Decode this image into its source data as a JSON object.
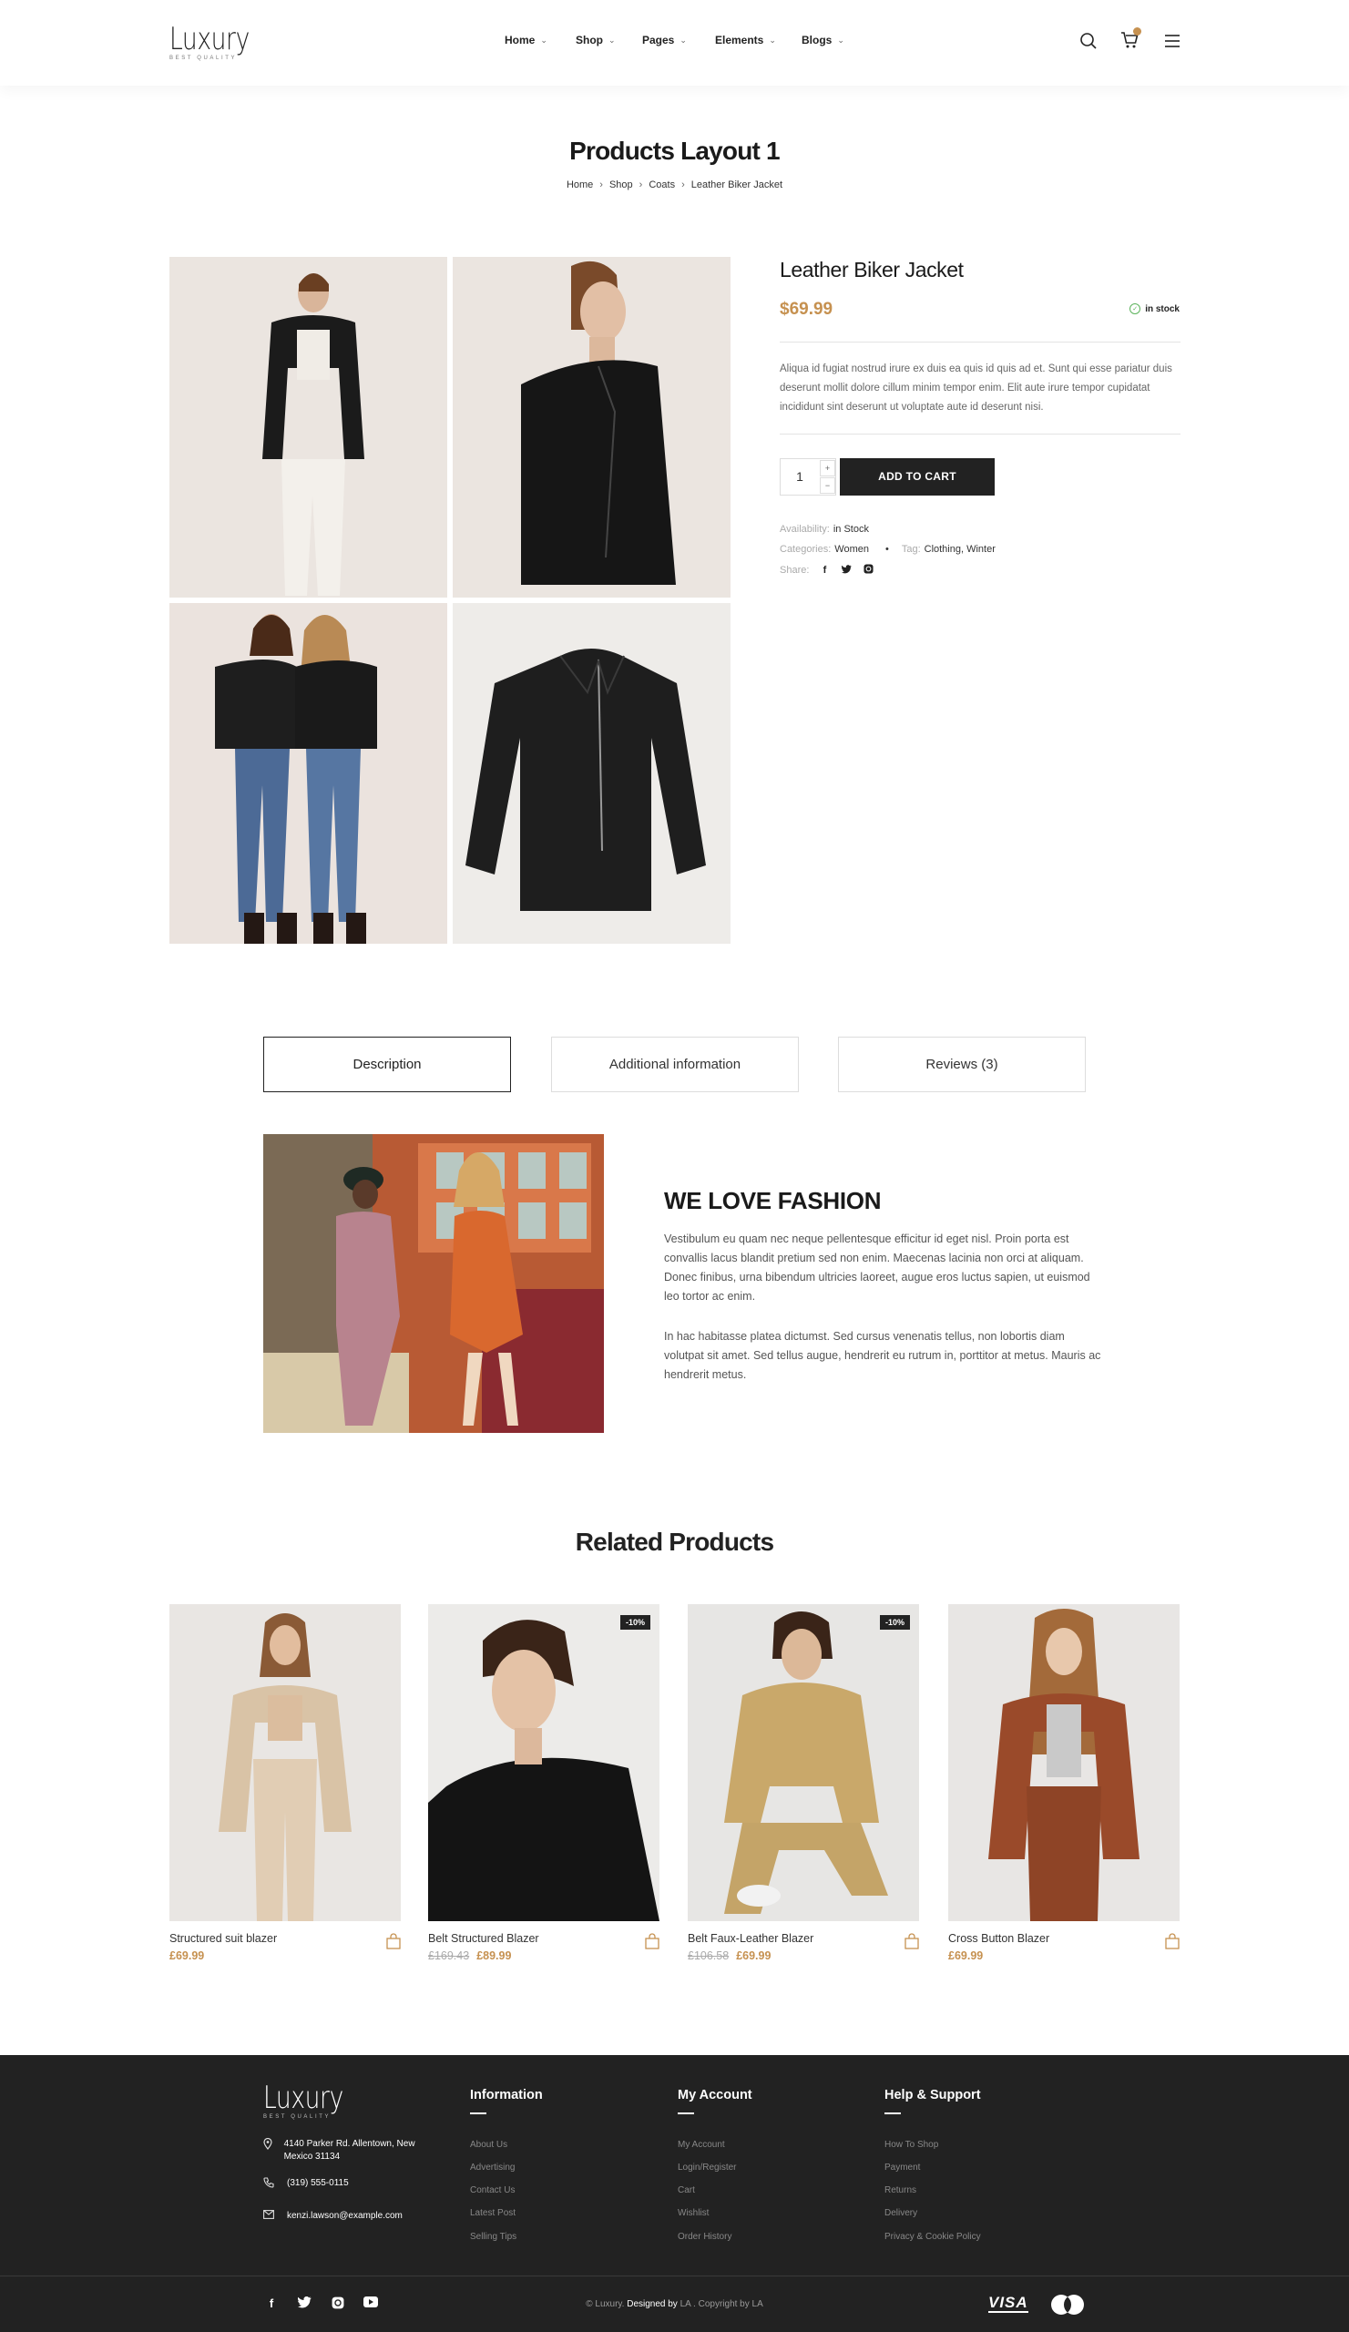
{
  "header": {
    "logo": {
      "word": "Luxury",
      "tagline": "BEST QUALITY"
    },
    "nav": [
      "Home",
      "Shop",
      "Pages",
      "Elements",
      "Blogs"
    ],
    "cart_count": ""
  },
  "page": {
    "title": "Products Layout 1",
    "breadcrumb": [
      "Home",
      "Shop",
      "Coats",
      "Leather Biker Jacket"
    ]
  },
  "product": {
    "name": "Leather Biker Jacket",
    "price": "$69.99",
    "stock": "in stock",
    "description": "Aliqua id fugiat nostrud irure ex duis ea quis id quis ad et. Sunt qui esse pariatur duis deserunt mollit dolore cillum minim tempor enim. Elit aute irure tempor cupidatat incididunt sint deserunt ut voluptate aute id deserunt nisi.",
    "quantity": "1",
    "add_to_cart": "ADD TO CART",
    "availability_label": "Availability:",
    "availability_value": "in Stock",
    "categories_label": "Categories:",
    "categories_value": "Women",
    "tag_label": "Tag:",
    "tag_value": "Clothing, Winter",
    "share_label": "Share:",
    "share_icons": [
      "facebook-icon",
      "twitter-icon",
      "instagram-icon"
    ]
  },
  "tabs": [
    "Description",
    "Additional information",
    "Reviews (3)"
  ],
  "description_section": {
    "heading": "WE LOVE FASHION",
    "paragraphs": [
      "Vestibulum eu quam nec neque pellentesque efficitur id eget nisl. Proin porta est convallis lacus blandit pretium sed non enim. Maecenas lacinia non orci at aliquam. Donec finibus, urna bibendum ultricies laoreet, augue eros luctus sapien, ut euismod leo tortor ac enim.",
      "In hac habitasse platea dictumst. Sed cursus venenatis tellus, non lobortis diam volutpat sit amet. Sed tellus augue, hendrerit eu rutrum in, porttitor at metus. Mauris ac hendrerit metus."
    ]
  },
  "related": {
    "title": "Related Products",
    "items": [
      {
        "name": "Structured suit blazer",
        "old_price": "",
        "price": "£69.99",
        "badge": ""
      },
      {
        "name": "Belt Structured Blazer",
        "old_price": "£169.43",
        "price": "£89.99",
        "badge": "-10%"
      },
      {
        "name": "Belt Faux-Leather Blazer",
        "old_price": "£106.58",
        "price": "£69.99",
        "badge": "-10%"
      },
      {
        "name": "Cross Button Blazer",
        "old_price": "",
        "price": "£69.99",
        "badge": ""
      }
    ]
  },
  "footer": {
    "logo": {
      "word": "Luxury",
      "tagline": "BEST QUALITY"
    },
    "address": "4140 Parker Rd. Allentown, New Mexico 31134",
    "phone": "(319) 555-0115",
    "email": "kenzi.lawson@example.com",
    "columns": [
      {
        "title": "Information",
        "links": [
          "About Us",
          "Advertising",
          "Contact Us",
          "Latest Post",
          "Selling Tips"
        ]
      },
      {
        "title": "My Account",
        "links": [
          "My Account",
          "Login/Register",
          "Cart",
          "Wishlist",
          "Order History"
        ]
      },
      {
        "title": "Help & Support",
        "links": [
          "How To Shop",
          "Payment",
          "Returns",
          "Delivery",
          "Privacy & Cookie Policy"
        ]
      }
    ],
    "copyright_prefix": "© Luxury.",
    "copyright_designed": "Designed by",
    "copyright_suffix": "LA . Copyright by LA",
    "payment": [
      "VISA"
    ],
    "social_icons": [
      "facebook-icon",
      "twitter-icon",
      "instagram-icon",
      "youtube-icon"
    ]
  },
  "colors": {
    "accent": "#c69150",
    "dark": "#222222",
    "stock_green": "#5bb35b"
  }
}
